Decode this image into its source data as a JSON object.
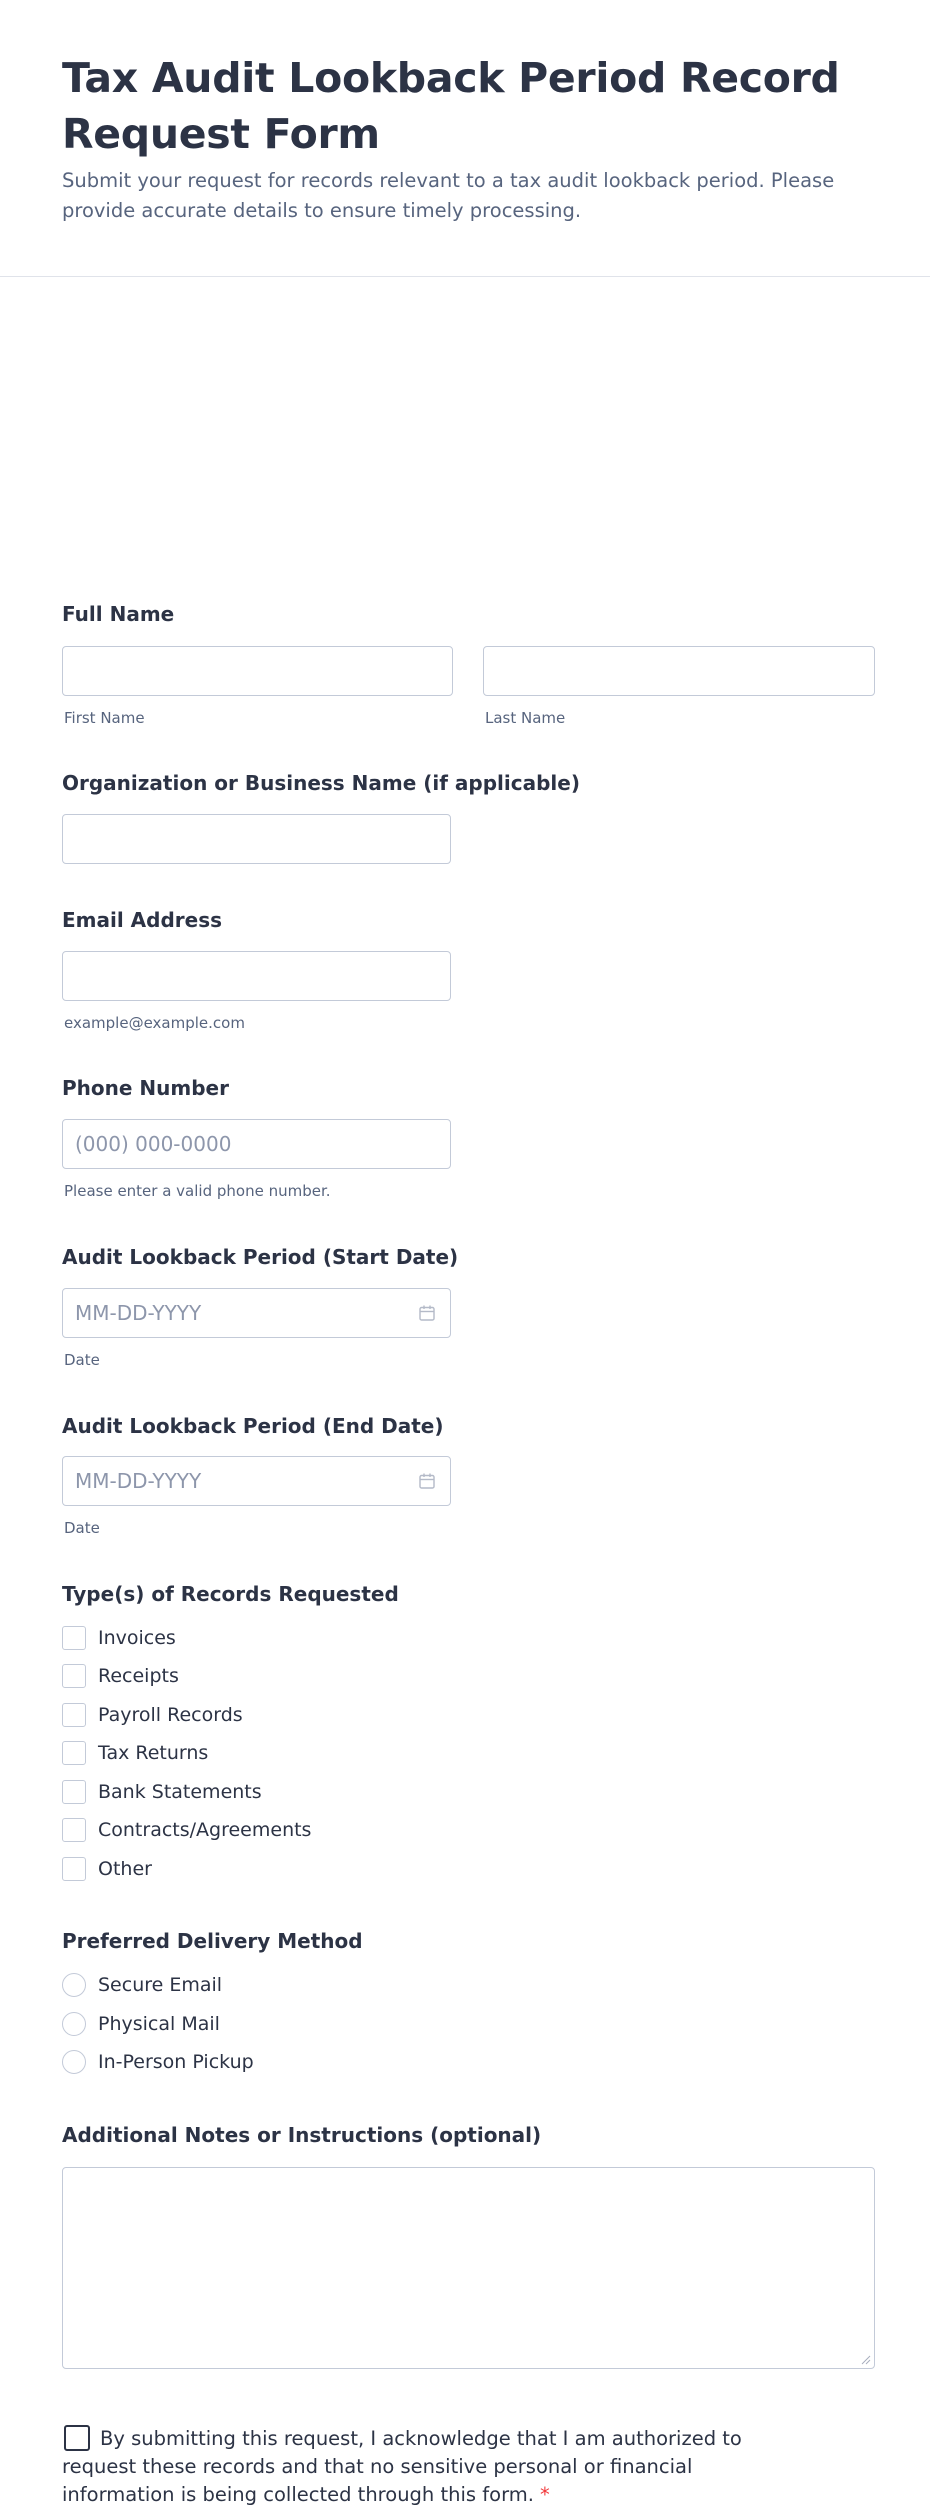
{
  "header": {
    "title": "Tax Audit Lookback Period Record Request Form",
    "subtitle": "Submit your request for records relevant to a tax audit lookback period. Please provide accurate details to ensure timely processing."
  },
  "full_name": {
    "label": "Full Name",
    "first_sub": "First Name",
    "last_sub": "Last Name"
  },
  "organization": {
    "label": "Organization or Business Name (if applicable)"
  },
  "email": {
    "label": "Email Address",
    "sub": "example@example.com"
  },
  "phone": {
    "label": "Phone Number",
    "placeholder": "(000) 000-0000",
    "sub": "Please enter a valid phone number."
  },
  "start_date": {
    "label": "Audit Lookback Period (Start Date)",
    "placeholder": "MM-DD-YYYY",
    "sub": "Date"
  },
  "end_date": {
    "label": "Audit Lookback Period (End Date)",
    "placeholder": "MM-DD-YYYY",
    "sub": "Date"
  },
  "records": {
    "label": "Type(s) of Records Requested",
    "options": [
      "Invoices",
      "Receipts",
      "Payroll Records",
      "Tax Returns",
      "Bank Statements",
      "Contracts/Agreements",
      "Other"
    ]
  },
  "delivery": {
    "label": "Preferred Delivery Method",
    "options": [
      "Secure Email",
      "Physical Mail",
      "In-Person Pickup"
    ]
  },
  "notes": {
    "label": "Additional Notes or Instructions (optional)"
  },
  "consent": {
    "text": "By submitting this request, I acknowledge that I am authorized to request these records and that no sensitive personal or financial information is being collected through this form.",
    "required_mark": "*"
  },
  "icons": {
    "calendar": "calendar-icon",
    "resize": "resize-handle-icon"
  }
}
